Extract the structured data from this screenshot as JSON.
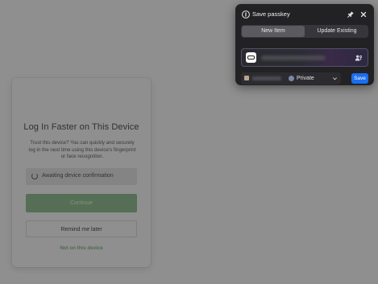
{
  "login_card": {
    "title": "Log In Faster on This Device",
    "description": "Trust this device? You can quickly and securely log in the next time using this device's fingerprint or face recognition.",
    "status_text": "Awaiting device confirmation",
    "continue_label": "Continue",
    "remind_label": "Remind me later",
    "not_device_label": "Not on this device"
  },
  "passkey_popup": {
    "title": "Save passkey",
    "tabs": [
      {
        "label": "New Item",
        "selected": true
      },
      {
        "label": "Update Existing",
        "selected": false
      }
    ],
    "vault_label": "Private",
    "save_label": "Save",
    "accent_color": "#1a6ef0"
  }
}
